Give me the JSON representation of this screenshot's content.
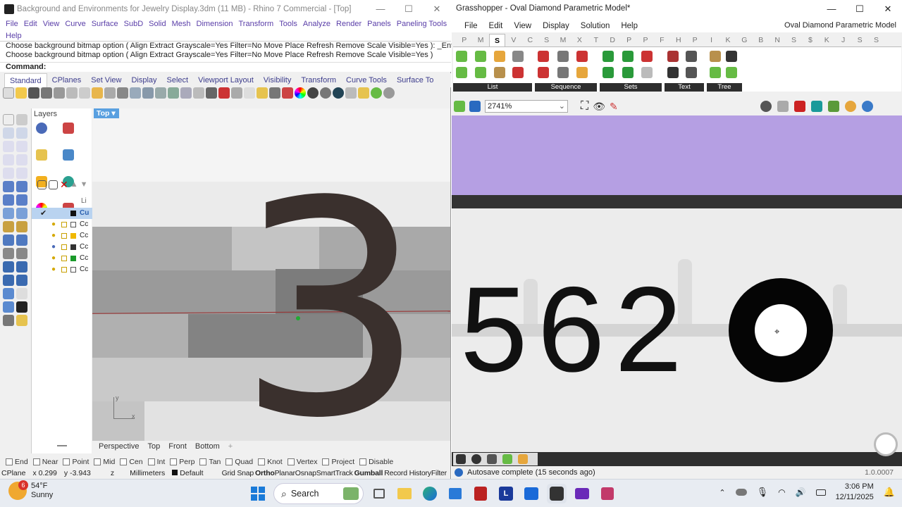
{
  "rhino": {
    "title": "Background and Environments for Jewelry Display.3dm (11 MB) - Rhino 7 Commercial - [Top]",
    "menu": [
      "File",
      "Edit",
      "View",
      "Curve",
      "Surface",
      "SubD",
      "Solid",
      "Mesh",
      "Dimension",
      "Transform",
      "Tools",
      "Analyze",
      "Render",
      "Panels",
      "Paneling Tools",
      "Help"
    ],
    "cmd_lines": [
      "Choose background bitmap option ( Align  Extract  Grayscale=Yes  Filter=No  Move  Place  Refresh  Remove  Scale  Visible=Yes ): _Enter",
      "Choose background bitmap option ( Align  Extract  Grayscale=Yes  Filter=No  Move  Place  Refresh  Remove  Scale  Visible=Yes )"
    ],
    "cmd_prompt": "Command:",
    "tabs": [
      "Standard",
      "CPlanes",
      "Set View",
      "Display",
      "Select",
      "Viewport Layout",
      "Visibility",
      "Transform",
      "Curve Tools",
      "Surface To"
    ],
    "layers_label": "Layers",
    "layers_col": "Li",
    "layer_names": [
      "Cu",
      "Cc",
      "Cc",
      "Cc",
      "Cc",
      "Cc"
    ],
    "viewport_label": "Top",
    "glyph": "3",
    "axis_y": "y",
    "axis_x": "x",
    "viewport_tabs": [
      "Perspective",
      "Top",
      "Front",
      "Bottom"
    ],
    "osnaps": [
      "End",
      "Near",
      "Point",
      "Mid",
      "Cen",
      "Int",
      "Perp",
      "Tan",
      "Quad",
      "Knot",
      "Vertex",
      "Project",
      "Disable"
    ],
    "status": {
      "cplane": "CPlane",
      "x": "x 0.299",
      "y": "y -3.943",
      "z": "z",
      "units": "Millimeters",
      "layer": "Default",
      "toggles": [
        "Grid Snap",
        "Ortho",
        "Planar",
        "Osnap",
        "SmartTrack",
        "Gumball",
        "Record History",
        "Filter"
      ]
    }
  },
  "grasshopper": {
    "title": "Grasshopper - Oval Diamond Parametric Model*",
    "menu": [
      "File",
      "Edit",
      "View",
      "Display",
      "Solution",
      "Help"
    ],
    "doc_name": "Oval Diamond Parametric Model",
    "categories": [
      "P",
      "M",
      "S",
      "V",
      "C",
      "S",
      "M",
      "X",
      "T",
      "D",
      "P",
      "P",
      "F",
      "H",
      "P",
      "I",
      "K",
      "G",
      "B",
      "N",
      "S",
      "$",
      "K",
      "J",
      "S",
      "S"
    ],
    "active_category": "S",
    "ribbon_groups": [
      "List",
      "Sequence",
      "Sets",
      "Text",
      "Tree"
    ],
    "zoom": "2741%",
    "panel_number": "562",
    "glyph": "2",
    "status_text": "Autosave complete (15 seconds ago)",
    "version": "1.0.0007"
  },
  "taskbar": {
    "temperature": "54°F",
    "condition": "Sunny",
    "badge": "6",
    "search_label": "Search",
    "time": "3:06 PM",
    "date": "12/11/2025"
  },
  "colors": {
    "rhino_menu": "#5a3ea8",
    "gh_purple": "#b59fe3",
    "viewport_glyph": "#3a302d",
    "accent_blue": "#5aa0e0"
  }
}
